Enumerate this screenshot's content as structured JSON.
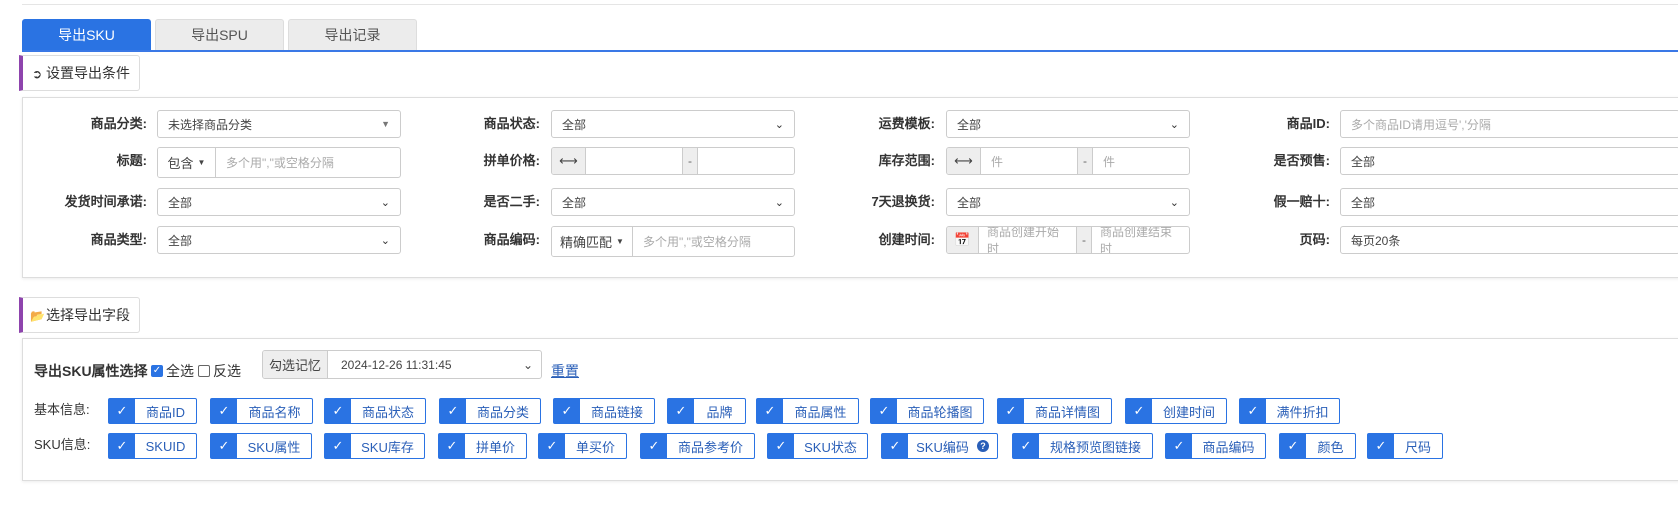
{
  "tabs": [
    {
      "label": "导出SKU",
      "active": true
    },
    {
      "label": "导出SPU",
      "active": false
    },
    {
      "label": "导出记录",
      "active": false
    }
  ],
  "conditions_header": "设置导出条件",
  "filters": {
    "category": {
      "label": "商品分类:",
      "value": "未选择商品分类"
    },
    "status": {
      "label": "商品状态:",
      "value": "全部"
    },
    "freight": {
      "label": "运费模板:",
      "value": "全部"
    },
    "goods_id": {
      "label": "商品ID:",
      "placeholder": "多个商品ID请用逗号','分隔"
    },
    "title": {
      "label": "标题:",
      "mode": "包含",
      "placeholder": "多个用\",\"或空格分隔"
    },
    "group_price": {
      "label": "拼单价格:",
      "sep": "-"
    },
    "stock": {
      "label": "库存范围:",
      "from_ph": "件",
      "sep": "-",
      "to_ph": "件"
    },
    "presale": {
      "label": "是否预售:",
      "value": "全部"
    },
    "ship_promise": {
      "label": "发货时间承诺:",
      "value": "全部"
    },
    "second_hand": {
      "label": "是否二手:",
      "value": "全部"
    },
    "return7": {
      "label": "7天退换货:",
      "value": "全部"
    },
    "fake_pay10": {
      "label": "假一赔十:",
      "value": "全部"
    },
    "goods_type": {
      "label": "商品类型:",
      "value": "全部"
    },
    "goods_code": {
      "label": "商品编码:",
      "mode": "精确匹配",
      "placeholder": "多个用\",\"或空格分隔"
    },
    "created": {
      "label": "创建时间:",
      "start_ph": "商品创建开始时",
      "sep": "-",
      "end_ph": "商品创建结束时"
    },
    "page_size": {
      "label": "页码:",
      "value": "每页20条"
    }
  },
  "fields_header": "选择导出字段",
  "fields": {
    "title": "导出SKU属性选择",
    "select_all": "全选",
    "invert": "反选",
    "memory_label": "勾选记忆",
    "memory_value": "2024-12-26 11:31:45",
    "reset": "重置",
    "basic_label": "基本信息:",
    "basic": [
      "商品ID",
      "商品名称",
      "商品状态",
      "商品分类",
      "商品链接",
      "品牌",
      "商品属性",
      "商品轮播图",
      "商品详情图",
      "创建时间",
      "满件折扣"
    ],
    "sku_label": "SKU信息:",
    "sku": [
      "SKUID",
      "SKU属性",
      "SKU库存",
      "拼单价",
      "单买价",
      "商品参考价",
      "SKU状态",
      "SKU编码",
      "规格预览图链接",
      "商品编码",
      "颜色",
      "尺码"
    ]
  },
  "colors": {
    "accent": "#2a73e3",
    "section_bar": "#8e44ad"
  }
}
